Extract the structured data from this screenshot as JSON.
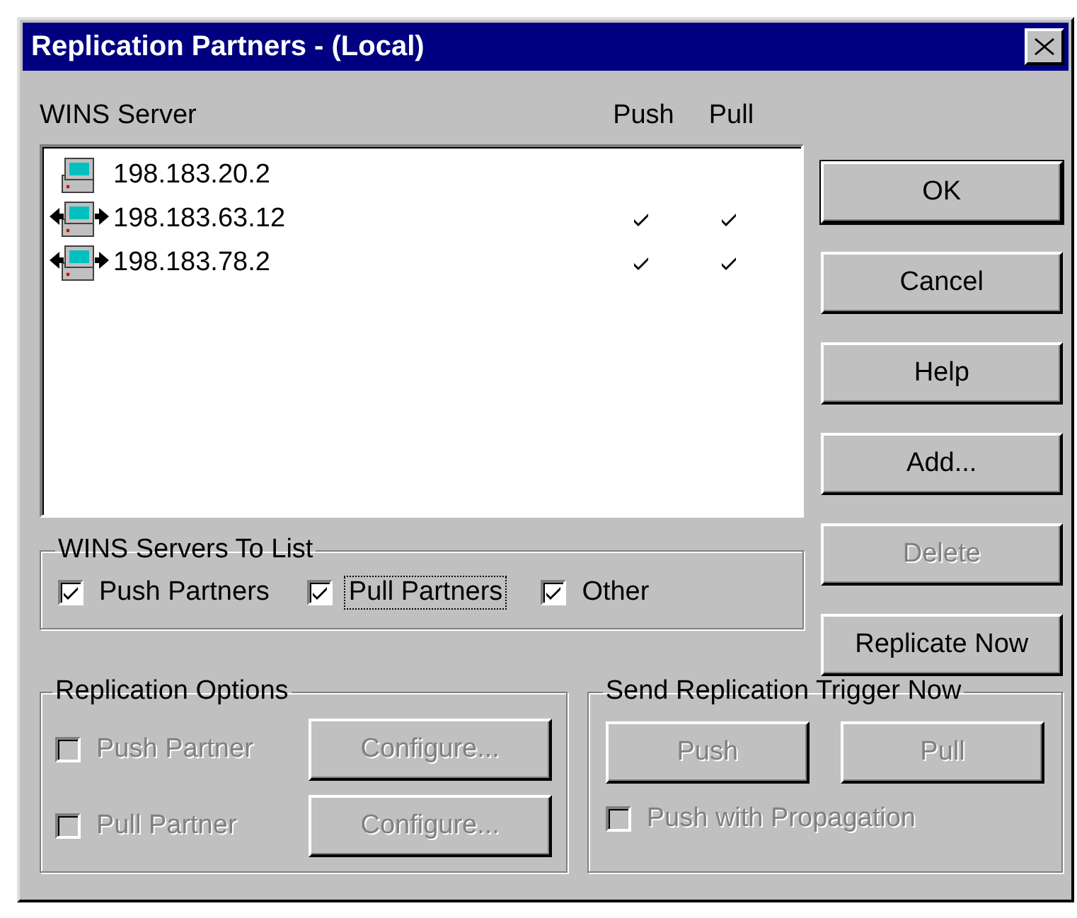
{
  "window": {
    "title": "Replication Partners - (Local)"
  },
  "server_list": {
    "label": "WINS Server",
    "columns": [
      "Push",
      "Pull"
    ],
    "rows": [
      {
        "address": "198.183.20.2",
        "kind": "local",
        "push": false,
        "pull": false
      },
      {
        "address": "198.183.63.12",
        "kind": "partner",
        "push": true,
        "pull": true
      },
      {
        "address": "198.183.78.2",
        "kind": "partner",
        "push": true,
        "pull": true
      }
    ]
  },
  "buttons": [
    {
      "label": "OK",
      "disabled": false,
      "default": true
    },
    {
      "label": "Cancel",
      "disabled": false,
      "default": false
    },
    {
      "label": "Help",
      "disabled": false,
      "default": false
    },
    {
      "label": "Add...",
      "disabled": false,
      "default": false
    },
    {
      "label": "Delete",
      "disabled": true,
      "default": false
    },
    {
      "label": "Replicate Now",
      "disabled": false,
      "default": false
    }
  ],
  "servers_to_list": {
    "title": "WINS Servers To List",
    "options": [
      {
        "label": "Push Partners",
        "checked": true,
        "focused": false
      },
      {
        "label": "Pull Partners",
        "checked": true,
        "focused": true
      },
      {
        "label": "Other",
        "checked": true,
        "focused": false
      }
    ]
  },
  "replication_options": {
    "title": "Replication Options",
    "rows": [
      {
        "label": "Push Partner",
        "checked": false,
        "disabled": true,
        "button": {
          "label": "Configure...",
          "disabled": true
        }
      },
      {
        "label": "Pull Partner",
        "checked": false,
        "disabled": true,
        "button": {
          "label": "Configure...",
          "disabled": true
        }
      }
    ]
  },
  "trigger": {
    "title": "Send Replication Trigger Now",
    "buttons": [
      {
        "label": "Push",
        "disabled": true
      },
      {
        "label": "Pull",
        "disabled": true
      }
    ],
    "propagation": {
      "label": "Push with Propagation",
      "checked": false,
      "disabled": true
    }
  }
}
